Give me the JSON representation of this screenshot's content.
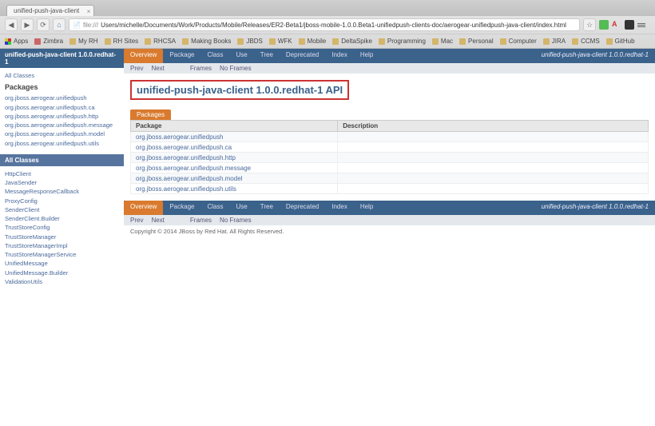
{
  "browser": {
    "tab_title": "unified-push-java-client",
    "url_prefix": "file:///",
    "url": "Users/michelle/Documents/Work/Products/Mobile/Releases/ER2-Beta1/jboss-mobile-1.0.0.Beta1-unifiedpush-clients-doc/aerogear-unifiedpush-java-client/index.html",
    "bookmarks": [
      "Apps",
      "Zimbra",
      "My RH",
      "RH Sites",
      "RHCSA",
      "Making Books",
      "JBDS",
      "WFK",
      "Mobile",
      "DeltaSpike",
      "Programming",
      "Mac",
      "Personal",
      "Computer",
      "JIRA",
      "CCMS",
      "GitHub"
    ]
  },
  "sidebar": {
    "top_title": "unified-push-java-client 1.0.0.redhat-1",
    "all_classes_link": "All Classes",
    "packages_label": "Packages",
    "packages": [
      "org.jboss.aerogear.unifiedpush",
      "org.jboss.aerogear.unifiedpush.ca",
      "org.jboss.aerogear.unifiedpush.http",
      "org.jboss.aerogear.unifiedpush.message",
      "org.jboss.aerogear.unifiedpush.model",
      "org.jboss.aerogear.unifiedpush.utils"
    ],
    "all_classes_title": "All Classes",
    "classes": [
      "HttpClient",
      "JavaSender",
      "MessageResponseCallback",
      "ProxyConfig",
      "SenderClient",
      "SenderClient.Builder",
      "TrustStoreConfig",
      "TrustStoreManager",
      "TrustStoreManagerImpl",
      "TrustStoreManagerService",
      "UnifiedMessage",
      "UnifiedMessage.Builder",
      "ValidationUtils"
    ]
  },
  "content": {
    "nav_tabs": [
      "Overview",
      "Package",
      "Class",
      "Use",
      "Tree",
      "Deprecated",
      "Index",
      "Help"
    ],
    "header_right": "unified-push-java-client 1.0.0.redhat-1",
    "subnav_prev": "Prev",
    "subnav_next": "Next",
    "subnav_frames": "Frames",
    "subnav_noframes": "No Frames",
    "api_title": "unified-push-java-client 1.0.0.redhat-1 API",
    "packages_tab": "Packages",
    "columns": {
      "package": "Package",
      "description": "Description"
    },
    "packages": [
      "org.jboss.aerogear.unifiedpush",
      "org.jboss.aerogear.unifiedpush.ca",
      "org.jboss.aerogear.unifiedpush.http",
      "org.jboss.aerogear.unifiedpush.message",
      "org.jboss.aerogear.unifiedpush.model",
      "org.jboss.aerogear.unifiedpush.utils"
    ],
    "footer": "Copyright © 2014 JBoss by Red Hat. All Rights Reserved."
  }
}
